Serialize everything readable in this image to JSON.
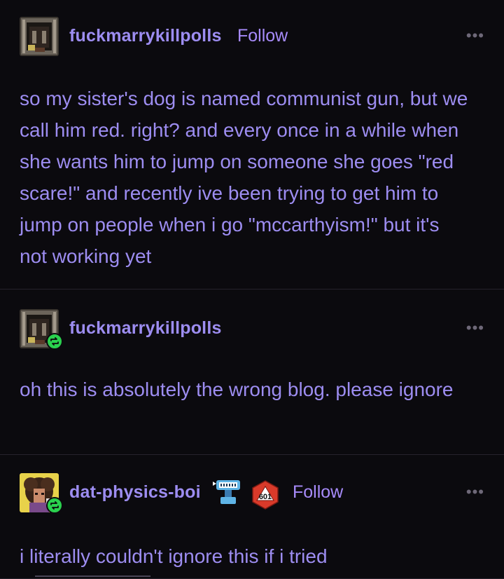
{
  "posts": [
    {
      "username": "fuckmarrykillpolls",
      "follow_label": "Follow",
      "more_label": "•••",
      "text": "so my sister's dog is named communist gun, but we call him red. right? and every once in a while when she wants him to jump on someone she goes \"red scare!\" and recently ive been trying to get him to jump on people when i go \"mccarthyism!\" but it's not working yet"
    },
    {
      "username": "fuckmarrykillpolls",
      "more_label": "•••",
      "reblog_icon": "reblog-icon",
      "text": "oh this is absolutely the wrong blog. please ignore"
    },
    {
      "username": "dat-physics-boi",
      "follow_label": "Follow",
      "more_label": "•••",
      "reblog_icon": "reblog-icon",
      "badge_number": "601",
      "text": "i literally couldn't ignore this if i tried"
    }
  ],
  "colors": {
    "background": "#0b0a0e",
    "text": "#9d8df1",
    "follow": "#a78bfa",
    "reblog_badge": "#2ad14e",
    "divider": "#26232c"
  }
}
